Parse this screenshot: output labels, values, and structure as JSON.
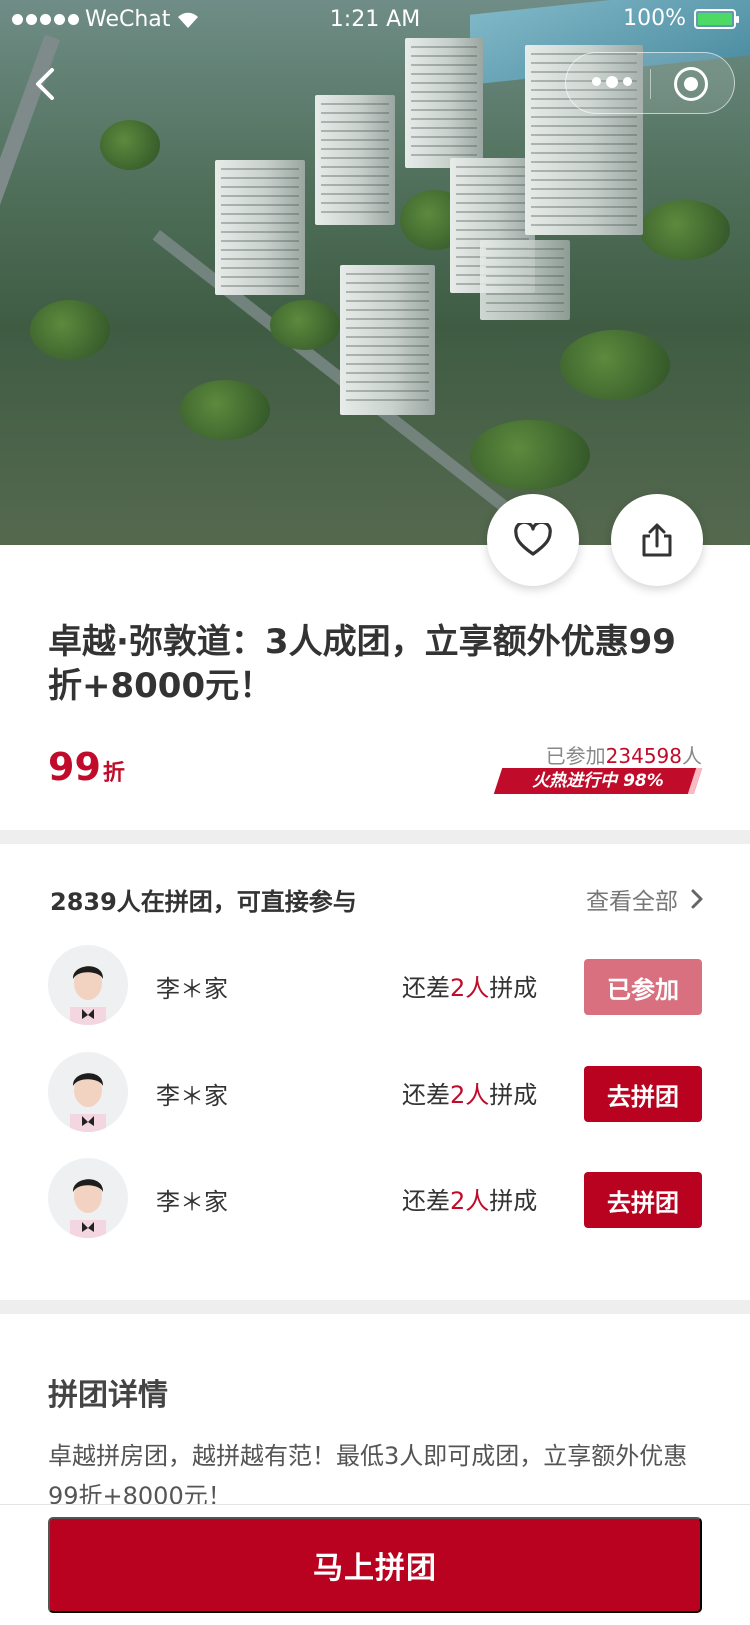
{
  "status_bar": {
    "carrier": "WeChat",
    "time": "1:21 AM",
    "battery": "100%"
  },
  "icons": {
    "back": "chevron-left-icon",
    "more": "more-dots-icon",
    "close": "target-circle-icon",
    "favorite": "heart-icon",
    "share": "share-icon",
    "view_all": "chevron-right-icon"
  },
  "product": {
    "title": "卓越·弥敦道：3人成团，立享额外优惠99折+8000元！",
    "discount_value": "99",
    "discount_unit": "折",
    "joined_prefix": "已参加",
    "joined_count": "234598",
    "joined_suffix": "人",
    "hot_label": "火热进行中 98%",
    "hot_progress": 0.98
  },
  "groups": {
    "header": "2839人在拼团，可直接参与",
    "view_all": "查看全部",
    "items": [
      {
        "name": "李＊家",
        "need_prefix": "还差",
        "need_count": "2人",
        "need_suffix": "拼成",
        "action": "已参加",
        "joined": true
      },
      {
        "name": "李＊家",
        "need_prefix": "还差",
        "need_count": "2人",
        "need_suffix": "拼成",
        "action": "去拼团",
        "joined": false
      },
      {
        "name": "李＊家",
        "need_prefix": "还差",
        "need_count": "2人",
        "need_suffix": "拼成",
        "action": "去拼团",
        "joined": false
      }
    ]
  },
  "details": {
    "heading": "拼团详情",
    "text": "卓越拼房团，越拼越有范！最低3人即可成团，立享额外优惠99折+8000元！"
  },
  "cta": {
    "label": "马上拼团"
  },
  "colors": {
    "brand": "#c00c2a",
    "joined_button": "#d9707f",
    "join_button": "#b8021f"
  }
}
